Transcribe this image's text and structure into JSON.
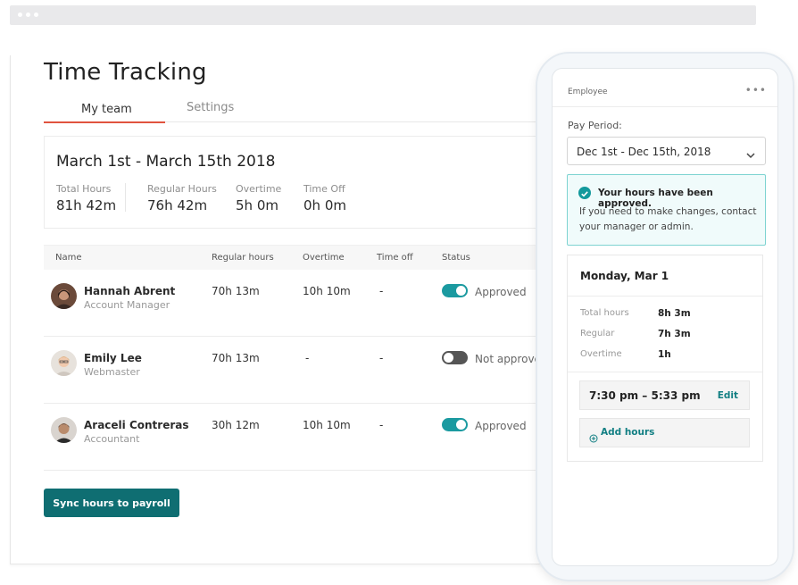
{
  "app": {
    "title": "Time Tracking",
    "tabs": [
      {
        "label": "My team",
        "active": true
      },
      {
        "label": "Settings",
        "active": false
      }
    ]
  },
  "summary": {
    "period": "March 1st - March 15th 2018",
    "stats": [
      {
        "label": "Total Hours",
        "value": "81h 42m"
      },
      {
        "label": "Regular Hours",
        "value": "76h 42m"
      },
      {
        "label": "Overtime",
        "value": "5h 0m"
      },
      {
        "label": "Time Off",
        "value": "0h 0m"
      }
    ]
  },
  "table": {
    "headers": [
      "Name",
      "Regular hours",
      "Overtime",
      "Time off",
      "Status"
    ],
    "rows": [
      {
        "name": "Hannah Abrent",
        "role": "Account Manager",
        "regular": "70h 13m",
        "overtime": "10h 10m",
        "time_off": "-",
        "status": "Approved",
        "approved": true
      },
      {
        "name": "Emily Lee",
        "role": "Webmaster",
        "regular": "70h 13m",
        "overtime": "-",
        "time_off": "-",
        "status": "Not approved",
        "approved": false
      },
      {
        "name": "Araceli Contreras",
        "role": "Accountant",
        "regular": "30h 12m",
        "overtime": "10h 10m",
        "time_off": "-",
        "status": "Approved",
        "approved": true
      }
    ]
  },
  "actions": {
    "sync_label": "Sync hours to payroll"
  },
  "phone": {
    "header_label": "Employee",
    "menu_icon": "more-dots-icon",
    "pay_period_label": "Pay Period:",
    "pay_period_value": "Dec 1st - Dec 15th, 2018",
    "alert": {
      "title": "Your hours have been approved.",
      "body": "If you need to make changes, contact your manager or admin."
    },
    "day": {
      "title": "Monday, Mar 1",
      "rows": [
        {
          "label": "Total hours",
          "value": "8h 3m"
        },
        {
          "label": "Regular",
          "value": "7h 3m"
        },
        {
          "label": "Overtime",
          "value": "1h"
        }
      ],
      "shift": "7:30 pm –  5:33 pm",
      "edit_label": "Edit",
      "add_label": "Add hours"
    }
  },
  "colors": {
    "accent_tab": "#e0533f",
    "teal": "#1b9aa0",
    "button": "#0f6e72"
  }
}
